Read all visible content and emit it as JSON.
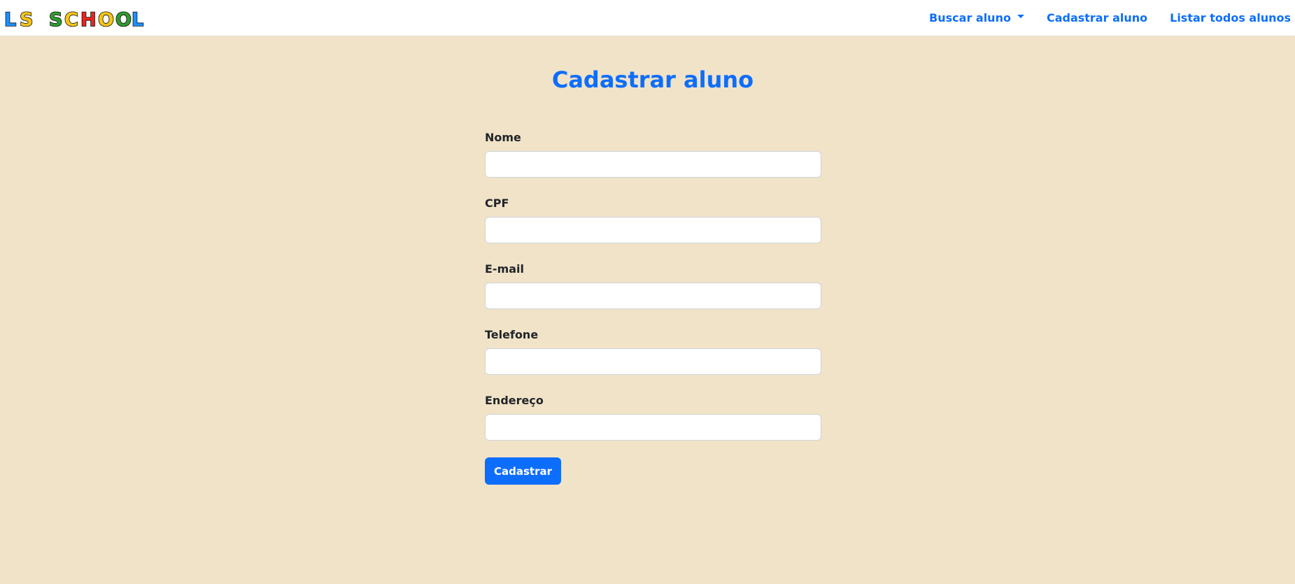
{
  "brand": {
    "logo_text": "LS SCHOOL",
    "letter_colors": [
      "#1e90ff",
      "#f5c518",
      "#2e9c2e",
      "#2e9c2e",
      "#e8251f",
      "#f5c518",
      "#2e9c2e",
      "#1e90ff"
    ]
  },
  "nav": {
    "items": [
      {
        "label": "Buscar aluno",
        "dropdown": true
      },
      {
        "label": "Cadastrar aluno"
      },
      {
        "label": "Listar todos alunos"
      }
    ]
  },
  "page": {
    "title": "Cadastrar aluno"
  },
  "form": {
    "fields": [
      {
        "label": "Nome",
        "value": ""
      },
      {
        "label": "CPF",
        "value": ""
      },
      {
        "label": "E-mail",
        "value": ""
      },
      {
        "label": "Telefone",
        "value": ""
      },
      {
        "label": "Endereço",
        "value": ""
      }
    ],
    "submit_label": "Cadastrar"
  },
  "colors": {
    "accent": "#0d6efd",
    "background": "#f1e3c8"
  }
}
